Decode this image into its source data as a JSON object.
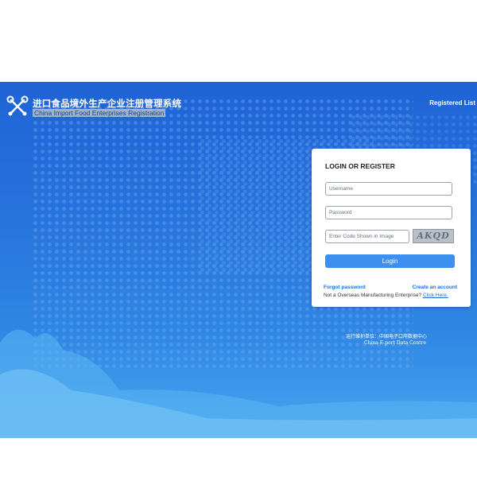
{
  "header": {
    "title_cn": "进口食品境外生产企业注册管理系统",
    "title_en": "China Import Food Enterprises Registration",
    "registered_list": "Registered List"
  },
  "login": {
    "title": "LOGIN OR REGISTER",
    "username_placeholder": "Username",
    "password_placeholder": "Password",
    "code_placeholder": "Enter Code Shown in Image",
    "captcha_text": "AKQD",
    "login_label": "Login",
    "forgot_password": "Forgot password",
    "create_account": "Create an account",
    "not_overseas_text": "Not a Overseas Manufacturing Enterprise? ",
    "click_here": "Click Here."
  },
  "footer": {
    "operator_cn": "运行维护单位：中国电子口岸数据中心",
    "operator_en": "China E-port Data Centre"
  },
  "colors": {
    "accent": "#3d8ff0",
    "link": "#1a6fd2",
    "background_top": "#1f63d6",
    "background_bottom": "#46a6ee"
  },
  "icons": {
    "logo": "wrench-tools-icon"
  }
}
